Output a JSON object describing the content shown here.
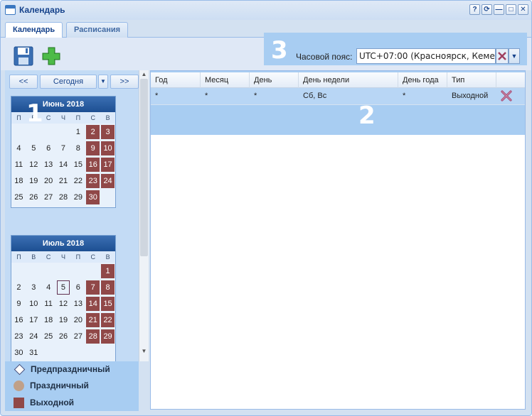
{
  "window": {
    "title": "Календарь",
    "tools": [
      "?",
      "⟳",
      "—",
      "□",
      "✕"
    ]
  },
  "tabs": [
    {
      "label": "Календарь",
      "active": true
    },
    {
      "label": "Расписания",
      "active": false
    }
  ],
  "toolbar": {
    "save_icon": "floppy-disk-icon",
    "add_icon": "plus-icon"
  },
  "timezone": {
    "label": "Часовой пояс:",
    "value": "UTC+07:00 (Красноярск, Кемерово)"
  },
  "callouts": {
    "one": "1",
    "two": "2",
    "three": "3"
  },
  "calendar_nav": {
    "prev": "<<",
    "today": "Сегодня",
    "next": ">>"
  },
  "months": [
    {
      "title": "Июнь 2018",
      "weekdays": [
        "П",
        "В",
        "С",
        "Ч",
        "П",
        "С",
        "В"
      ],
      "offset": 4,
      "days": 30,
      "weekend_days": [
        2,
        3,
        9,
        10,
        16,
        17,
        23,
        24,
        30
      ],
      "today": null
    },
    {
      "title": "Июль 2018",
      "weekdays": [
        "П",
        "В",
        "С",
        "Ч",
        "П",
        "С",
        "В"
      ],
      "offset": 6,
      "days": 31,
      "weekend_days": [
        1,
        7,
        8,
        14,
        15,
        21,
        22,
        28,
        29
      ],
      "today": 5
    }
  ],
  "legend": [
    {
      "label": "Предпраздничный",
      "icon": "diamond-icon"
    },
    {
      "label": "Праздничный",
      "icon": "circle-icon",
      "color": "#c0a088"
    },
    {
      "label": "Выходной",
      "icon": "square-icon",
      "color": "#904848"
    }
  ],
  "grid": {
    "columns": [
      "Год",
      "Месяц",
      "День",
      "День недели",
      "День года",
      "Тип",
      ""
    ],
    "rows": [
      {
        "year": "*",
        "month": "*",
        "day": "*",
        "weekday": "Сб, Вс",
        "yearday": "*",
        "type": "Выходной"
      }
    ]
  },
  "colors": {
    "weekend": "#904848",
    "header": "#1d4f92",
    "highlight": "#a8cdf2"
  }
}
